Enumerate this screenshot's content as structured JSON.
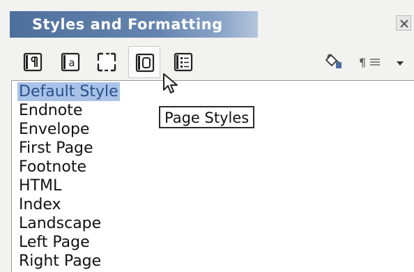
{
  "window": {
    "title": "Styles and Formatting"
  },
  "toolbar": {
    "buttons": [
      {
        "name": "Paragraph Styles",
        "icon": "paragraph-styles-icon"
      },
      {
        "name": "Character Styles",
        "icon": "character-styles-icon"
      },
      {
        "name": "Frame Styles",
        "icon": "frame-styles-icon"
      },
      {
        "name": "Page Styles",
        "icon": "page-styles-icon",
        "active": true
      },
      {
        "name": "List Styles",
        "icon": "list-styles-icon"
      }
    ],
    "right_buttons": [
      {
        "name": "Fill Format Mode",
        "icon": "fill-format-bucket-icon"
      },
      {
        "name": "New Style from Selection",
        "icon": "new-style-paragraph-icon"
      },
      {
        "name": "More options",
        "icon": "dropdown-arrow-icon"
      }
    ]
  },
  "styles_list": {
    "selected": "Default Style",
    "items": [
      "Default Style",
      "Endnote",
      "Envelope",
      "First Page",
      "Footnote",
      "HTML",
      "Index",
      "Landscape",
      "Left Page",
      "Right Page"
    ]
  },
  "tooltip": {
    "text": "Page Styles"
  },
  "colors": {
    "title_bar": "#5a7aa8",
    "selection": "#a9c3e8",
    "selection_text": "#2c4f8c"
  }
}
